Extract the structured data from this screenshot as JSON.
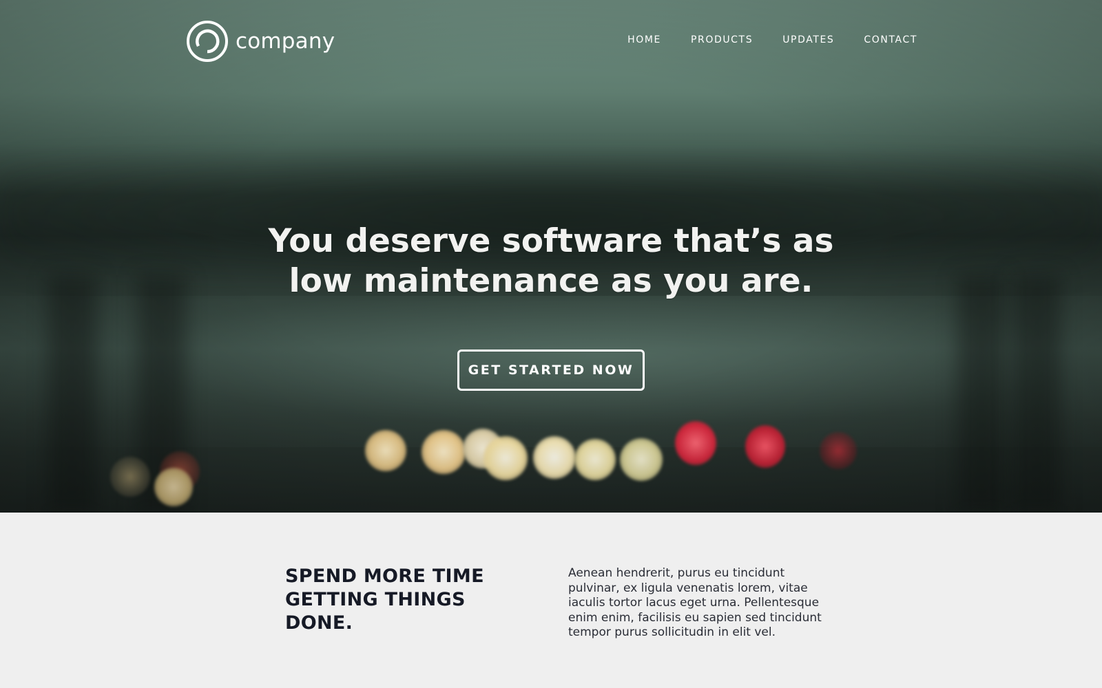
{
  "brand": {
    "name": "company",
    "accent": "#ffffff",
    "logo_icon": "ring-logo-icon"
  },
  "nav": {
    "items": [
      {
        "label": "HOME"
      },
      {
        "label": "PRODUCTS"
      },
      {
        "label": "UPDATES"
      },
      {
        "label": "CONTACT"
      }
    ]
  },
  "hero": {
    "headline_line1": "You deserve software that’s as",
    "headline_line2": "low maintenance as you are.",
    "cta_label": "GET STARTED NOW"
  },
  "section": {
    "title_line1": "SPEND MORE TIME",
    "title_line2": "GETTING THINGS DONE.",
    "body": "Aenean hendrerit, purus eu tincidunt pulvinar, ex ligula venenatis lorem, vitae iaculis tortor lacus eget urna. Pellentesque enim enim, facilisis eu sapien sed tincidunt tempor purus sollicitudin in elit vel."
  },
  "colors": {
    "hero_tint": "#5f7d70",
    "section_bg": "#efefef",
    "heading_dark": "#161a26"
  }
}
